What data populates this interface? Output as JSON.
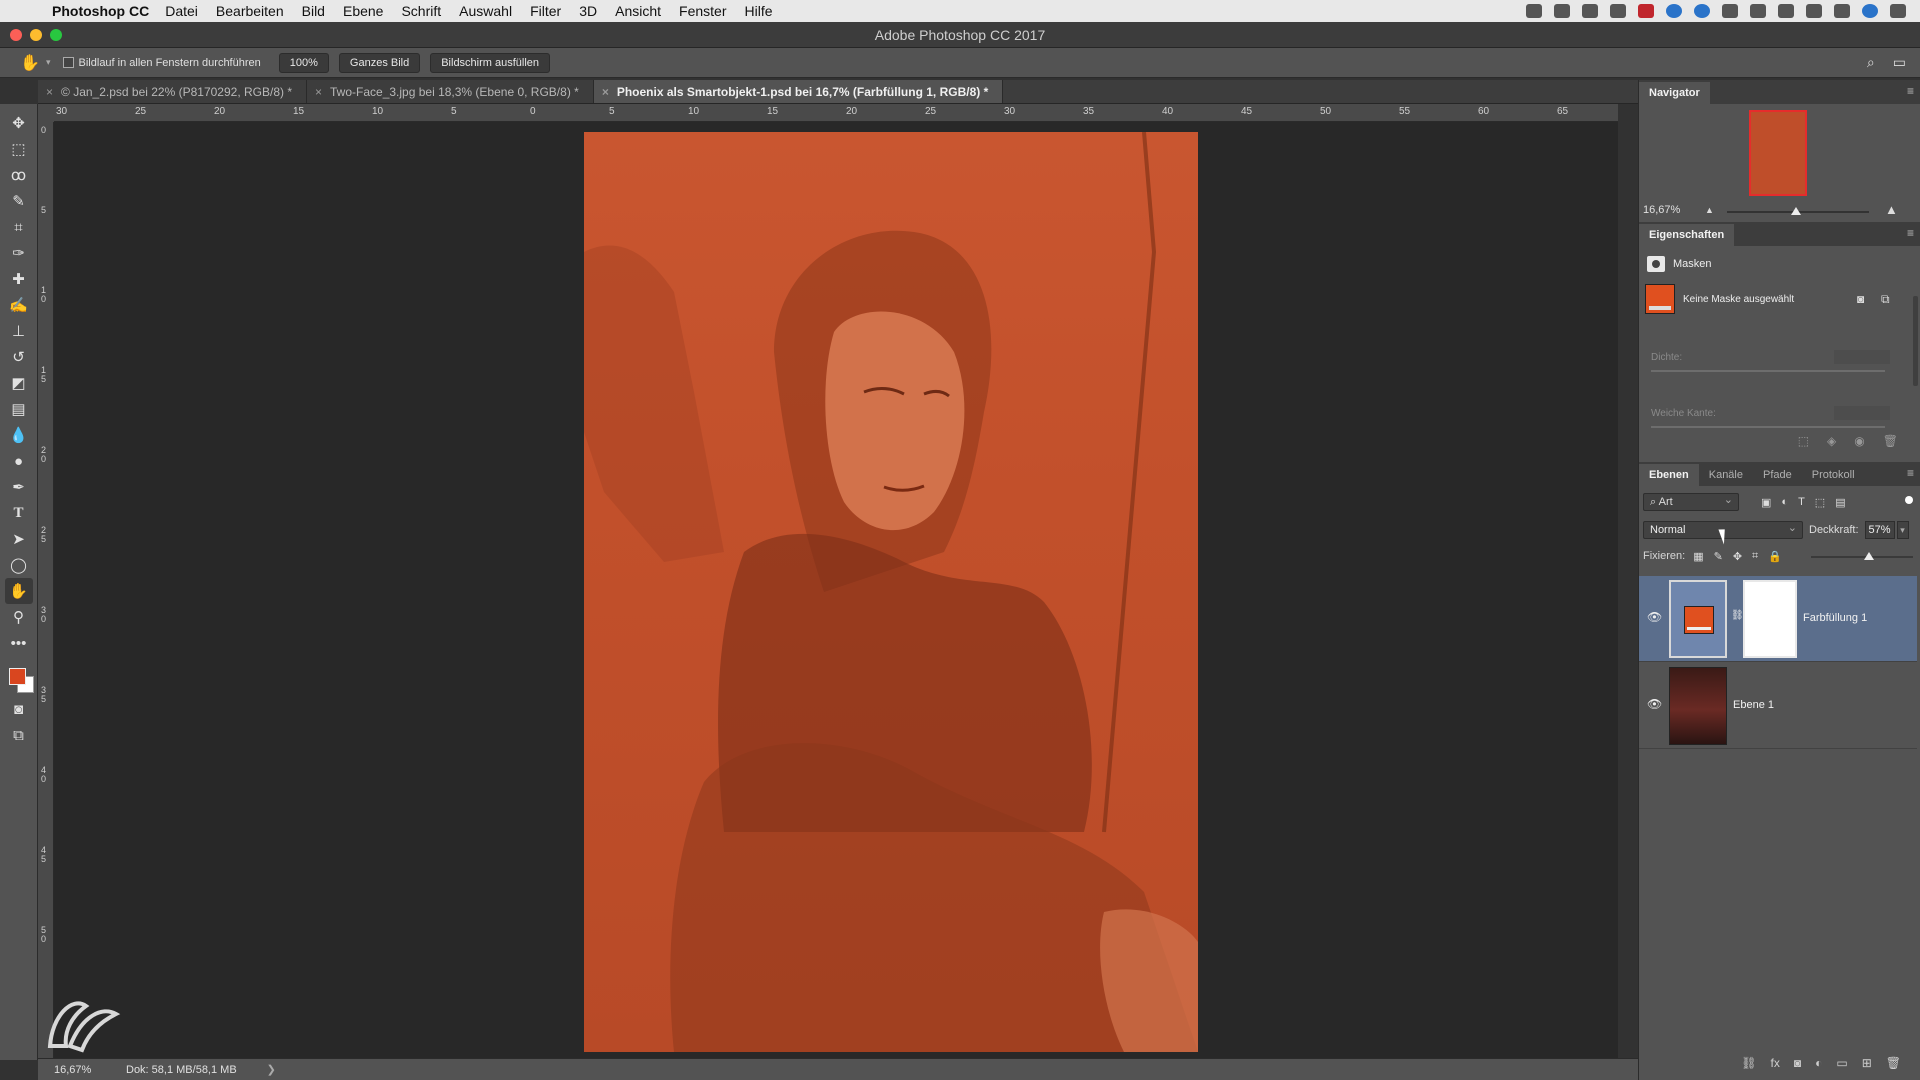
{
  "menubar": {
    "app_name": "Photoshop CC",
    "items": [
      "Datei",
      "Bearbeiten",
      "Bild",
      "Ebene",
      "Schrift",
      "Auswahl",
      "Filter",
      "3D",
      "Ansicht",
      "Fenster",
      "Hilfe"
    ],
    "status_icons": [
      "record-icon",
      "dropbox-icon",
      "screen-icon",
      "creative-cloud-icon",
      "app-icon",
      "skype-icon",
      "dropbox-icon",
      "cloud-icon",
      "airplay-icon",
      "time-machine-icon",
      "bluetooth-icon",
      "wifi-icon",
      "search-icon",
      "siri-icon",
      "list-icon"
    ]
  },
  "window": {
    "title": "Adobe Photoshop CC 2017"
  },
  "options_bar": {
    "scroll_all_label": "Bildlauf in allen Fenstern durchführen",
    "zoom_100": "100%",
    "fit_screen": "Ganzes Bild",
    "fill_screen": "Bildschirm ausfüllen"
  },
  "tabs": [
    {
      "label": "© Jan_2.psd bei 22% (P8170292, RGB/8) *"
    },
    {
      "label": "Two-Face_3.jpg bei 18,3% (Ebene 0, RGB/8) *"
    },
    {
      "label": "Phoenix als Smartobjekt-1.psd bei 16,7% (Farbfüllung 1, RGB/8) *"
    }
  ],
  "ruler": {
    "horizontal": [
      "30",
      "25",
      "20",
      "15",
      "10",
      "5",
      "0",
      "5",
      "10",
      "15",
      "20",
      "25",
      "30",
      "35",
      "40",
      "45",
      "50",
      "55",
      "60",
      "65"
    ],
    "vertical": [
      "0",
      "5",
      "10",
      "15",
      "20",
      "25",
      "30",
      "35",
      "40",
      "45",
      "50"
    ]
  },
  "statusbar": {
    "zoom": "16,67%",
    "doc": "Dok: 58,1 MB/58,1 MB"
  },
  "navigator": {
    "title": "Navigator",
    "zoom": "16,67%"
  },
  "properties": {
    "title": "Eigenschaften",
    "section": "Masken",
    "no_mask": "Keine Maske ausgewählt",
    "density": "Dichte:",
    "feather": "Weiche Kante:"
  },
  "layers_panel": {
    "tabs": [
      "Ebenen",
      "Kanäle",
      "Pfade",
      "Protokoll"
    ],
    "filter": "Art",
    "blend_mode": "Normal",
    "opacity_label": "Deckkraft:",
    "opacity": "57%",
    "opacity_fraction": 0.57,
    "lock_label": "Fixieren:",
    "layers": [
      {
        "name": "Farbfüllung 1",
        "selected": true
      },
      {
        "name": "Ebene 1",
        "selected": false
      }
    ]
  },
  "colors": {
    "foreground": "#d9461f",
    "background": "#ffffff",
    "overlay": "#c95630"
  }
}
